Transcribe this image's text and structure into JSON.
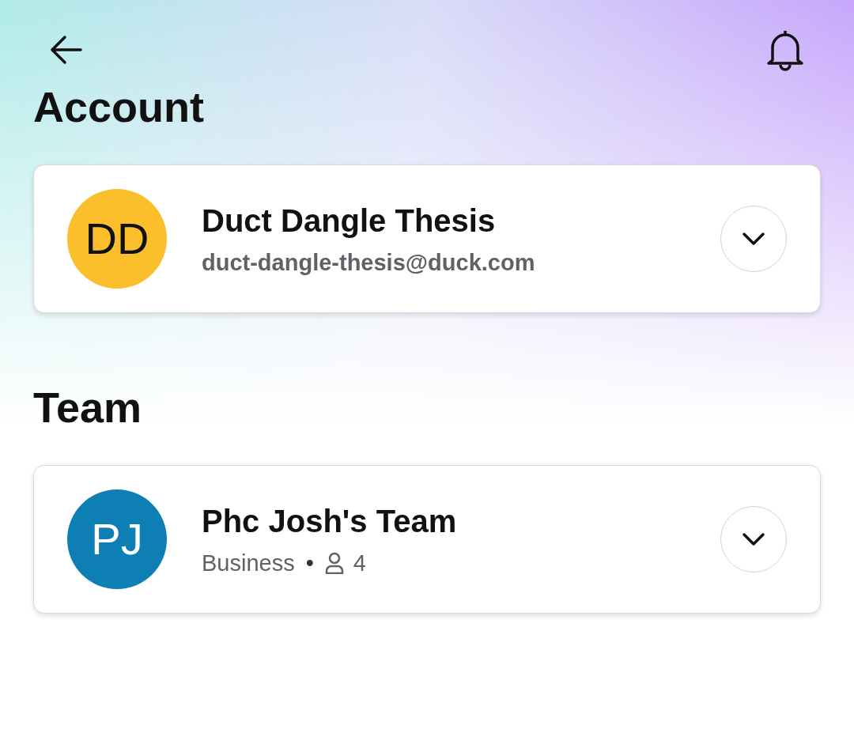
{
  "sections": [
    {
      "heading": "Account",
      "card": {
        "kind": "account",
        "initials": "DD",
        "color": "#fbbf2c",
        "name": "Duct Dangle Thesis",
        "email": "duct-dangle-thesis@duck.com"
      }
    },
    {
      "heading": "Team",
      "card": {
        "kind": "team",
        "initials": "PJ",
        "color": "#0d7fb5",
        "name": "Phc Josh's Team",
        "plan": "Business",
        "separator": "•",
        "members": "4"
      }
    }
  ]
}
